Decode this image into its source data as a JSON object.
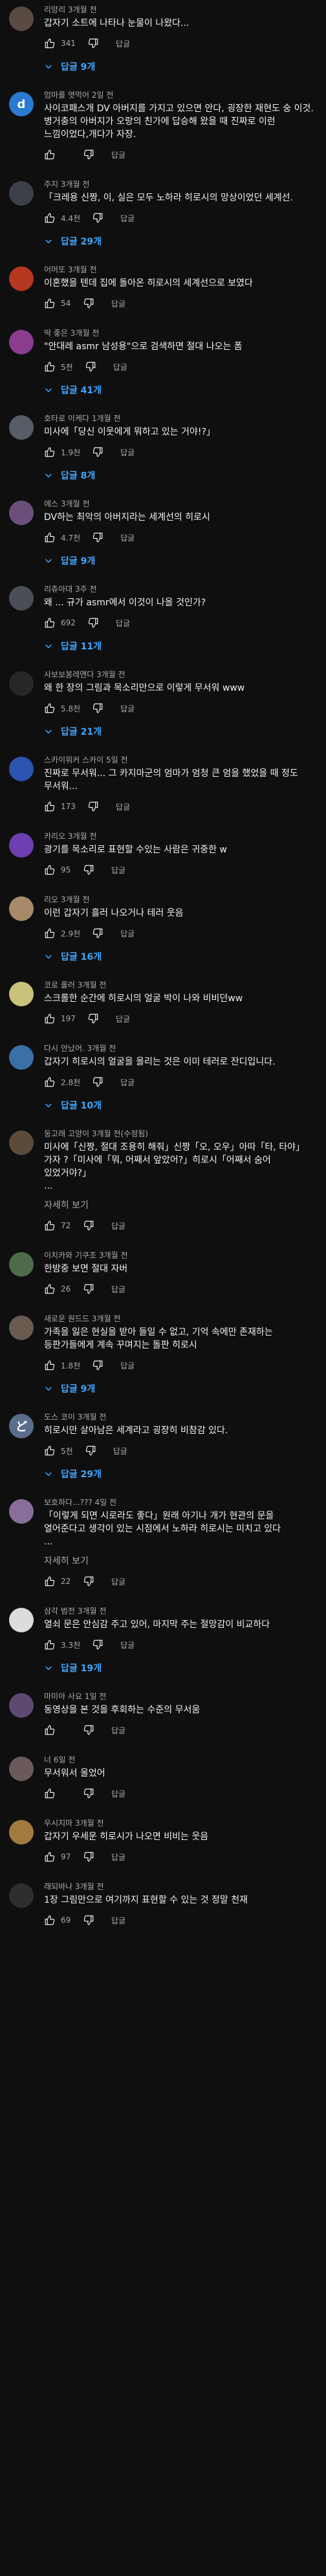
{
  "labels": {
    "reply": "답글",
    "read_more": "자세히 보기"
  },
  "comments": [
    {
      "author": "리앙리",
      "time": "3개월 전",
      "edited": "",
      "text": "갑자기 소트에 나타나 눈물이 나왔다...",
      "read_more": false,
      "likes": "341",
      "replies": "답글 9개",
      "avatar_color": "#5a4a44",
      "avatar_letter": ""
    },
    {
      "author": "엄마를 엿먹어",
      "time": "2일 전",
      "edited": "",
      "text": "사이코패스개 DV 아버지를 가지고 있으면 안다, 굉장한 재현도 숭 이것. 병거충의 아버지가 오랑의 친가에 답승해 왔을 때 진짜로 이런 느낌이었다,개다가 자장.",
      "read_more": false,
      "likes": "",
      "replies": "",
      "avatar_color": "#2a7ad1",
      "avatar_letter": "d"
    },
    {
      "author": "주지",
      "time": "3개월 전",
      "edited": "",
      "text": "「크레용 신짱, 이, 실은 모두 노하라 히로시의 망상이었던 세계선.",
      "read_more": false,
      "likes": "4.4천",
      "replies": "답글 29개",
      "avatar_color": "#3c4148",
      "avatar_letter": ""
    },
    {
      "author": "어머또",
      "time": "3개월 전",
      "edited": "",
      "text": "이혼했을 텐데 집에 돌아온 히로시의 세계선으로 보였다",
      "read_more": false,
      "likes": "54",
      "replies": "",
      "avatar_color": "#b5371f",
      "avatar_letter": ""
    },
    {
      "author": "딱 좋은",
      "time": "3개월 전",
      "edited": "",
      "text": "\"안대레 asmr 남성용\"으로 검색하면 절대 나오는 폼",
      "read_more": false,
      "likes": "5천",
      "replies": "답글 41개",
      "avatar_color": "#8a3d8e",
      "avatar_letter": ""
    },
    {
      "author": "호타로 이케다",
      "time": "1개월 전",
      "edited": "",
      "text": "미사에「당신 이웃에게 뭐하고 있는 거야!?」",
      "read_more": false,
      "likes": "1.9천",
      "replies": "답글 8개",
      "avatar_color": "#555d66",
      "avatar_letter": ""
    },
    {
      "author": "에스",
      "time": "3개월 전",
      "edited": "",
      "text": "DV하는 최악의 아버지라는 세계선의 히로시",
      "read_more": false,
      "likes": "4.7천",
      "replies": "답글 9개",
      "avatar_color": "#6b4f7a",
      "avatar_letter": ""
    },
    {
      "author": "리츄아대",
      "time": "3주 전",
      "edited": "",
      "text": "왜 ... 규가 asmr에서 이것이 나올 것인가?",
      "read_more": false,
      "likes": "692",
      "replies": "답글 11개",
      "avatar_color": "#4a4e57",
      "avatar_letter": ""
    },
    {
      "author": "사보보봉레앤다",
      "time": "3개월 전",
      "edited": "",
      "text": "왜 한 장의 그림과 목소리만으로 이렇게 무서워 www",
      "read_more": false,
      "likes": "5.8천",
      "replies": "답글 21개",
      "avatar_color": "#272727",
      "avatar_letter": ""
    },
    {
      "author": "스카이워커 스카이",
      "time": "5일 전",
      "edited": "",
      "text": "진짜로 무서워... 그 카지마군의 엄마가 엄청 큰 엄을 했었을 때 정도 무서워...",
      "read_more": false,
      "likes": "173",
      "replies": "",
      "avatar_color": "#2b55b0",
      "avatar_letter": ""
    },
    {
      "author": "카리오",
      "time": "3개월 전",
      "edited": "",
      "text": "광기를 목소리로 표현할 수있는 사람은 귀중한 w",
      "read_more": false,
      "likes": "95",
      "replies": "",
      "avatar_color": "#6d3fb0",
      "avatar_letter": ""
    },
    {
      "author": "리오",
      "time": "3개월 전",
      "edited": "",
      "text": "이런 갑자기 흘러 나오거나 테러 웃음",
      "read_more": false,
      "likes": "2.9천",
      "replies": "답글 16개",
      "avatar_color": "#a88a6a",
      "avatar_letter": ""
    },
    {
      "author": "코로 롤러",
      "time": "3개월 전",
      "edited": "",
      "text": "스크롤한 순간에 히로시의 얼굴 박이 나와 비비던ww",
      "read_more": false,
      "likes": "197",
      "replies": "",
      "avatar_color": "#c9c27a",
      "avatar_letter": ""
    },
    {
      "author": "다시 안났어.",
      "time": "3개월 전",
      "edited": "",
      "text": "갑자기 히로시의 얼굴을 올리는 것은 이미 테러로 잔디입니다.",
      "read_more": false,
      "likes": "2.8천",
      "replies": "답글 10개",
      "avatar_color": "#3a6fa8",
      "avatar_letter": ""
    },
    {
      "author": "둥고래 고양이",
      "time": "3개월 전",
      "edited": "(수정됨)",
      "text": "미사에「신짱, 절대 조용히 해줘」신짱「오, 오우」아따「타, 타야」가자 ?「미사에「뭐, 어째서 앞았어?」히로시「어째서 숨어 있었거야?」\n...",
      "read_more": true,
      "likes": "72",
      "replies": "",
      "avatar_color": "#5c4a3a",
      "avatar_letter": ""
    },
    {
      "author": "이치카와 기쿠조",
      "time": "3개월 전",
      "edited": "",
      "text": "한밤중 보면 절대 자버",
      "read_more": false,
      "likes": "26",
      "replies": "",
      "avatar_color": "#4e6b4a",
      "avatar_letter": ""
    },
    {
      "author": "새로운 원드드",
      "time": "3개월 전",
      "edited": "",
      "text": "가족을 잃은 현실을 받아 들일 수 없고, 기억 속에만 존재하는 등판가들에게 계속 꾸며지는 돌판 히로시",
      "read_more": false,
      "likes": "1.8천",
      "replies": "답글 9개",
      "avatar_color": "#6a5a50",
      "avatar_letter": ""
    },
    {
      "author": "도스 코이",
      "time": "3개월 전",
      "edited": "",
      "text": "히로시만 살아남은 세계라고 굉장히 비참감 있다.",
      "read_more": false,
      "likes": "5천",
      "replies": "답글 29개",
      "avatar_color": "#5a6e8c",
      "avatar_letter": "ど"
    },
    {
      "author": "보호하다...???",
      "time": "4일 전",
      "edited": "",
      "text": "「이렇게 되면 시로라도 좋다」원래 아기나 개가 현관의 문을 열어준다고 생각이 있는 시점에서 노하라 히로시는 미치고 있다\n...",
      "read_more": true,
      "likes": "22",
      "replies": "",
      "avatar_color": "#8a6e9a",
      "avatar_letter": ""
    },
    {
      "author": "삼각 범전",
      "time": "3개월 전",
      "edited": "",
      "text": "열쇠 문은 안심감 주고 있어, 마지막 주는 절망감이 비교하다",
      "read_more": false,
      "likes": "3.3천",
      "replies": "답글 19개",
      "avatar_color": "#dcdcdc",
      "avatar_letter": ""
    },
    {
      "author": "마미아 사요",
      "time": "1일 전",
      "edited": "",
      "text": "동영상을 본 것을 후회하는 수준의 무서움",
      "read_more": false,
      "likes": "",
      "replies": "",
      "avatar_color": "#5e4a70",
      "avatar_letter": ""
    },
    {
      "author": "너",
      "time": "6일 전",
      "edited": "",
      "text": "무서워서 울었어",
      "read_more": false,
      "likes": "",
      "replies": "",
      "avatar_color": "#6b5a5a",
      "avatar_letter": ""
    },
    {
      "author": "우시지마",
      "time": "3개월 전",
      "edited": "",
      "text": "갑자기 우세운 히로시가 나오면 비비는 웃음",
      "read_more": false,
      "likes": "97",
      "replies": "",
      "avatar_color": "#a07a40",
      "avatar_letter": ""
    },
    {
      "author": "래되바나",
      "time": "3개월 전",
      "edited": "",
      "text": "1장 그림만으로 여기까지 표현할 수 있는 것 정말 천재",
      "read_more": false,
      "likes": "69",
      "replies": "",
      "avatar_color": "#2e2e2e",
      "avatar_letter": ""
    }
  ]
}
